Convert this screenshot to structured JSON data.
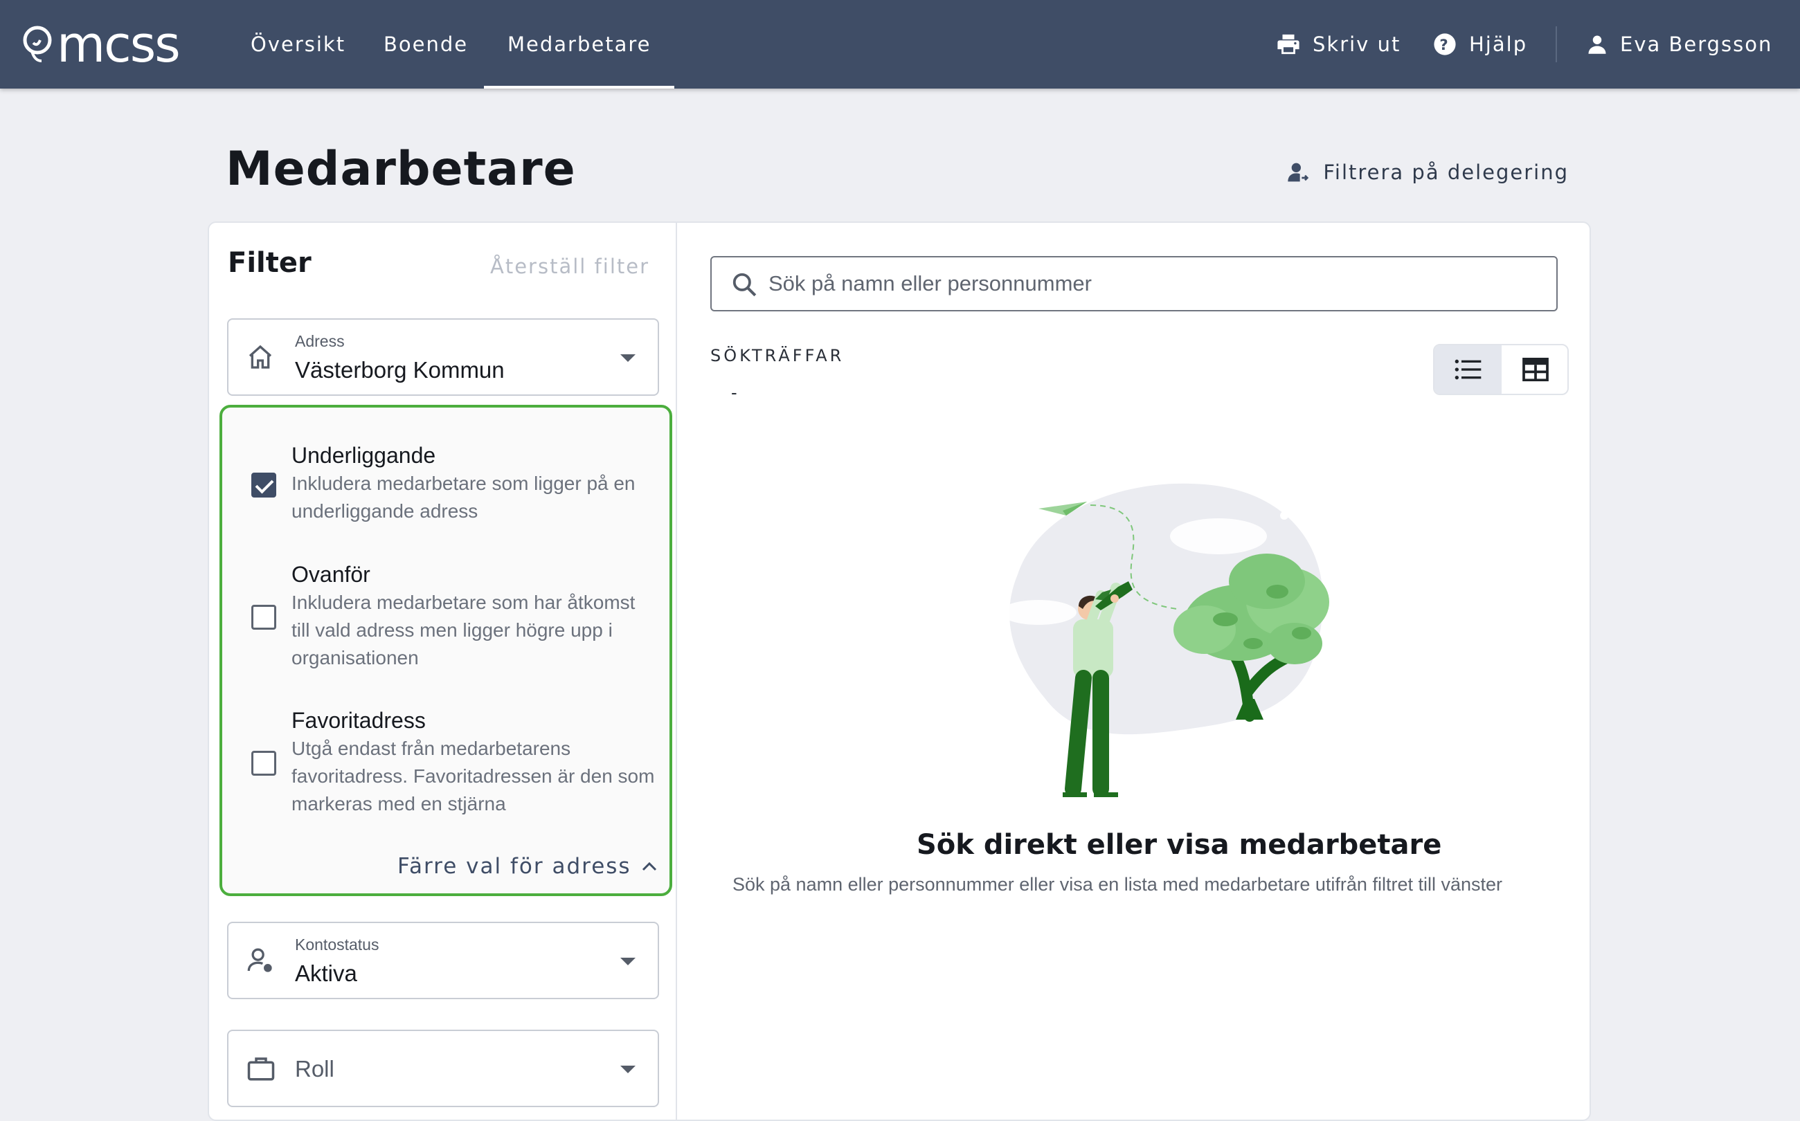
{
  "app": {
    "logo_text": "mcss"
  },
  "nav": {
    "items": [
      {
        "label": "Översikt"
      },
      {
        "label": "Boende"
      },
      {
        "label": "Medarbetare"
      }
    ],
    "active": "Medarbetare",
    "print_label": "Skriv ut",
    "help_label": "Hjälp",
    "user_name": "Eva Bergsson"
  },
  "page": {
    "title": "Medarbetare",
    "delegation_filter_label": "Filtrera på delegering"
  },
  "filter": {
    "title": "Filter",
    "reset_label": "Återställ filter",
    "address": {
      "label": "Adress",
      "value": "Västerborg Kommun"
    },
    "address_options": [
      {
        "title": "Underliggande",
        "description": "Inkludera medarbetare som ligger på en underliggande adress",
        "checked": true
      },
      {
        "title": "Ovanför",
        "description": "Inkludera medarbetare som har åtkomst till vald adress men ligger högre upp i organisationen",
        "checked": false
      },
      {
        "title": "Favoritadress",
        "description": "Utgå endast från medarbetarens favoritadress. Favoritadressen är den som markeras med en stjärna",
        "checked": false
      }
    ],
    "fewer_options_label": "Färre val för adress",
    "account_status": {
      "label": "Kontostatus",
      "value": "Aktiva"
    },
    "role": {
      "placeholder": "Roll"
    }
  },
  "search": {
    "placeholder": "Sök på namn eller personnummer",
    "value": "",
    "hits_label": "SÖKTRÄFFAR",
    "hits_value": "-"
  },
  "view_toggle": {
    "selected": "list"
  },
  "empty_state": {
    "title": "Sök direkt eller visa medarbetare",
    "description": "Sök på namn eller personnummer eller visa en lista med medarbetare utifrån filtret till vänster"
  },
  "colors": {
    "topbar": "#3f4d66",
    "accent_green": "#4cae3e",
    "checkbox_checked": "#3f4d66",
    "background": "#eeeff3"
  }
}
